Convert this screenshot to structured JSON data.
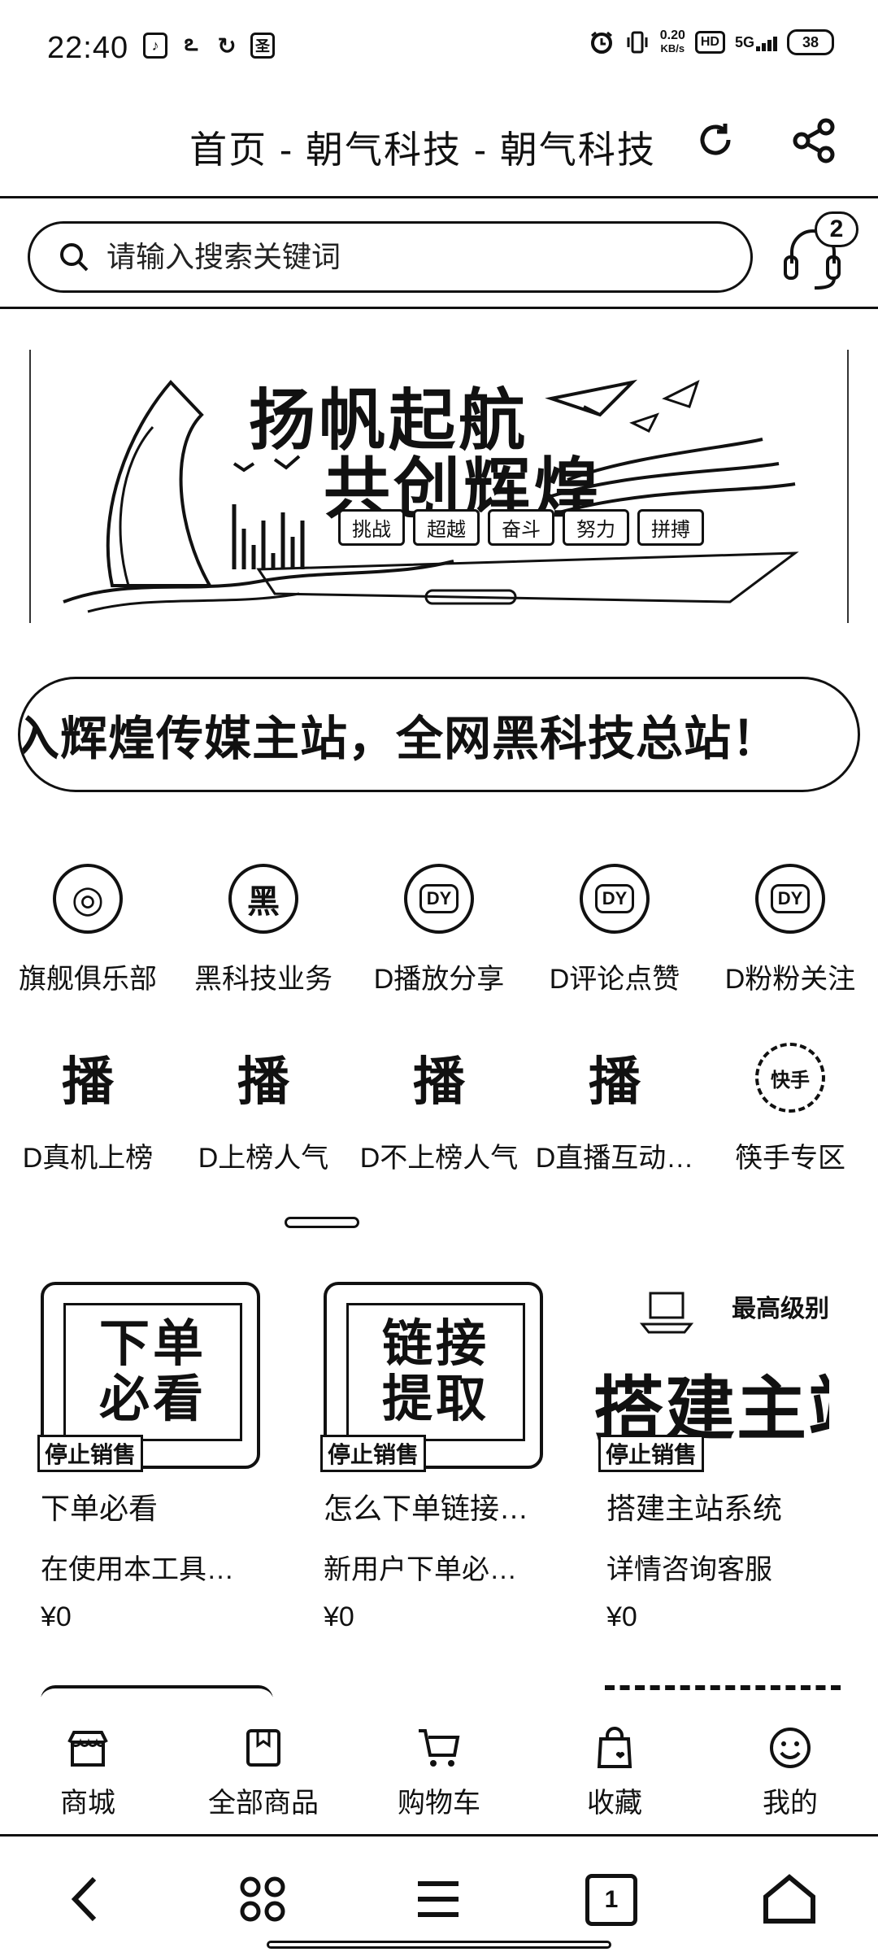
{
  "status_bar": {
    "time": "22:40",
    "left_icons": [
      "tiktok-icon",
      "qq-icon",
      "app-icon",
      "gallery-icon"
    ],
    "net_speed_value": "0.20",
    "net_speed_unit": "KB/s",
    "hd_label": "HD",
    "network_label": "5G",
    "battery_level": "38"
  },
  "header": {
    "title": "首页 - 朝气科技 - 朝气科技",
    "refresh_icon": "refresh-icon",
    "share_icon": "share-icon"
  },
  "search": {
    "placeholder": "请输入搜索关键词",
    "support_badge": "2"
  },
  "banner": {
    "line1": "扬帆起航",
    "line2": "共创辉煌",
    "tags": [
      "挑战",
      "超越",
      "奋斗",
      "努力",
      "拼搏"
    ]
  },
  "marquee": {
    "text": "入辉煌传媒主站，全网黑科技总站！"
  },
  "categories": [
    [
      {
        "label": "旗舰俱乐部",
        "icon_text": "◎",
        "icon_style": "circle"
      },
      {
        "label": "黑科技业务",
        "icon_text": "黑",
        "icon_style": "circle"
      },
      {
        "label": "D播放分享",
        "icon_text": "DY",
        "icon_style": "dy"
      },
      {
        "label": "D评论点赞",
        "icon_text": "DY",
        "icon_style": "dy"
      },
      {
        "label": "D粉粉关注",
        "icon_text": "DY",
        "icon_style": "dy"
      }
    ],
    [
      {
        "label": "D真机上榜",
        "icon_text": "播",
        "icon_style": "plain"
      },
      {
        "label": "D上榜人气",
        "icon_text": "播",
        "icon_style": "plain"
      },
      {
        "label": "D不上榜人气",
        "icon_text": "播",
        "icon_style": "plain"
      },
      {
        "label": "D直播互动…",
        "icon_text": "播",
        "icon_style": "plain"
      },
      {
        "label": "筷手专区",
        "icon_text": "快手",
        "icon_style": "small"
      }
    ]
  ],
  "products": [
    {
      "thumb_text_1": "下单",
      "thumb_text_2": "必看",
      "badge": "停止销售",
      "name": "下单必看",
      "desc": "在使用本工具…",
      "price": "¥0"
    },
    {
      "thumb_text_1": "链接",
      "thumb_text_2": "提取",
      "badge": "停止销售",
      "name": "怎么下单链接…",
      "desc": "新用户下单必…",
      "price": "¥0"
    },
    {
      "thumb_tag": "最高级别",
      "thumb_big": "搭建主站",
      "badge": "停止销售",
      "name": "搭建主站系统",
      "desc": "详情咨询客服",
      "price": "¥0"
    }
  ],
  "app_nav": [
    {
      "label": "商城",
      "icon": "store-icon"
    },
    {
      "label": "全部商品",
      "icon": "catalog-icon"
    },
    {
      "label": "购物车",
      "icon": "cart-icon"
    },
    {
      "label": "收藏",
      "icon": "favorite-bag-icon"
    },
    {
      "label": "我的",
      "icon": "smile-icon"
    }
  ],
  "system_nav": {
    "tab_count": "1"
  }
}
